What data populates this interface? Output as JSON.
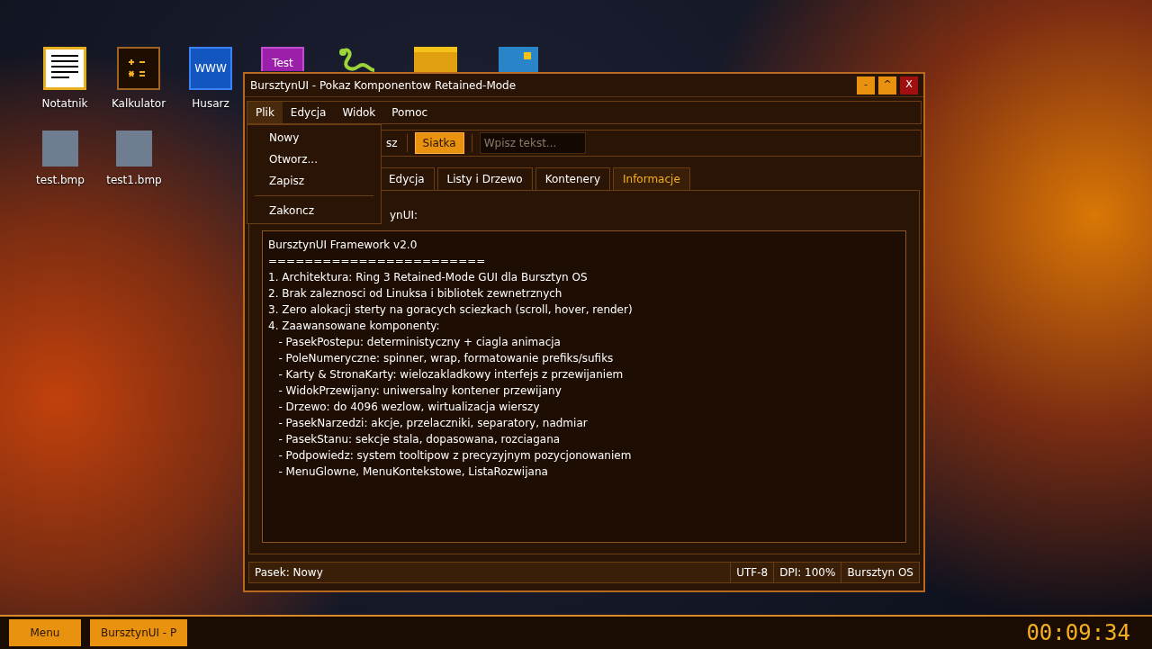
{
  "desktop_icons": [
    {
      "kind": "notepad",
      "label": "Notatnik"
    },
    {
      "kind": "calculator",
      "label": "Kalkulator"
    },
    {
      "kind": "browser",
      "label": "Husarz",
      "glyph": "WWW"
    },
    {
      "kind": "test",
      "glyph": "Test"
    },
    {
      "kind": "snake"
    },
    {
      "kind": "folder"
    },
    {
      "kind": "picture"
    },
    {
      "kind": "bitmap",
      "label": "test.bmp"
    },
    {
      "kind": "bitmap",
      "label": "test1.bmp"
    }
  ],
  "window": {
    "title": "BursztynUI - Pokaz Komponentow Retained-Mode",
    "controls": [
      "-",
      "^",
      "X"
    ],
    "menu_bar": [
      {
        "label": "Plik",
        "selected": true
      },
      {
        "label": "Edycja",
        "selected": false
      },
      {
        "label": "Widok",
        "selected": false
      },
      {
        "label": "Pomoc",
        "selected": false
      }
    ],
    "menu": [
      {
        "kind": "item",
        "label": "Nowy"
      },
      {
        "kind": "item",
        "label": "Otworz..."
      },
      {
        "kind": "item",
        "label": "Zapisz"
      },
      {
        "kind": "separator"
      },
      {
        "kind": "item",
        "label": "Zakoncz"
      }
    ],
    "toolbar": {
      "partial_button": "sz",
      "toggle": {
        "label": "Siatka",
        "on": true
      },
      "input": {
        "placeholder": "Wpisz tekst..."
      }
    },
    "tabs": [
      {
        "label": "Edycja",
        "selected": false
      },
      {
        "label": "Listy i Drzewo",
        "selected": false
      },
      {
        "label": "Kontenery",
        "selected": false
      },
      {
        "label": "Informacje",
        "selected": true
      }
    ],
    "content_label": "ynUI:",
    "info_lines": [
      "BursztynUI Framework v2.0",
      "========================",
      "1. Architektura: Ring 3 Retained-Mode GUI dla Bursztyn OS",
      "2. Brak zaleznosci od Linuksa i bibliotek zewnetrznych",
      "3. Zero alokacji sterty na goracych sciezkach (scroll, hover, render)",
      "4. Zaawansowane komponenty:",
      "   - PasekPostepu: deterministyczny + ciagla animacja",
      "   - PoleNumeryczne: spinner, wrap, formatowanie prefiks/sufiks",
      "   - Karty & StronaKarty: wielozakladkowy interfejs z przewijaniem",
      "   - WidokPrzewijany: uniwersalny kontener przewijany",
      "   - Drzewo: do 4096 wezlow, wirtualizacja wierszy",
      "   - PasekNarzedzi: akcje, przelaczniki, separatory, nadmiar",
      "   - PasekStanu: sekcje stala, dopasowana, rozciagana",
      "   - Podpowiedz: system tooltipow z precyzyjnym pozycjonowaniem",
      "   - MenuGlowne, MenuKontekstowe, ListaRozwijana"
    ],
    "status_bar": [
      "Pasek: Nowy",
      "UTF-8",
      "DPI: 100%",
      "Bursztyn OS"
    ]
  },
  "taskbar": {
    "menu_button": "Menu",
    "tasks": [
      {
        "label": "BursztynUI - P",
        "selected": true
      }
    ],
    "clock": "00:09:34"
  }
}
